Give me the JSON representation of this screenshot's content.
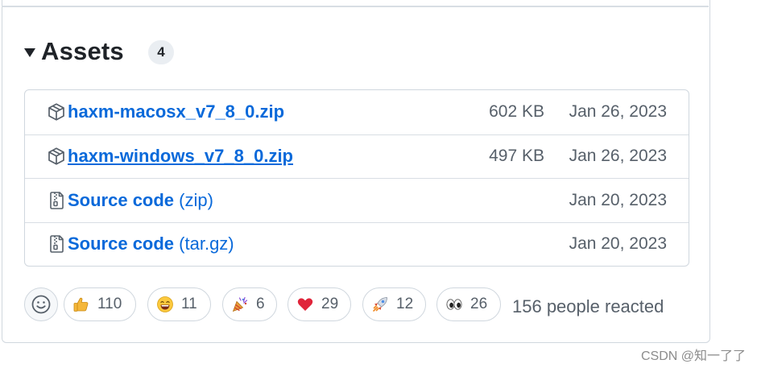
{
  "assets": {
    "title": "Assets",
    "count": "4",
    "items": [
      {
        "icon": "package-icon",
        "name": "haxm-macosx_v7_8_0.zip",
        "suffix": "",
        "size": "602 KB",
        "date": "Jan 26, 2023"
      },
      {
        "icon": "package-icon",
        "name": "haxm-windows_v7_8_0.zip",
        "suffix": "",
        "size": "497 KB",
        "date": "Jan 26, 2023"
      },
      {
        "icon": "file-zip-icon",
        "name": "Source code",
        "suffix": "(zip)",
        "size": "",
        "date": "Jan 20, 2023"
      },
      {
        "icon": "file-zip-icon",
        "name": "Source code",
        "suffix": "(tar.gz)",
        "size": "",
        "date": "Jan 20, 2023"
      }
    ]
  },
  "reactions": {
    "items": [
      {
        "icon": "thumbs-up-emoji",
        "count": "110"
      },
      {
        "icon": "laugh-emoji",
        "count": "11"
      },
      {
        "icon": "hooray-emoji",
        "count": "6"
      },
      {
        "icon": "heart-emoji",
        "count": "29"
      },
      {
        "icon": "rocket-emoji",
        "count": "12"
      },
      {
        "icon": "eyes-emoji",
        "count": "26"
      }
    ],
    "summary": "156 people reacted"
  },
  "watermark": "CSDN @知一了了"
}
